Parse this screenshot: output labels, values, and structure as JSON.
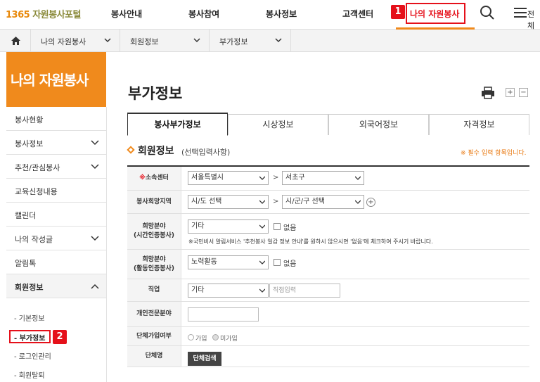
{
  "header": {
    "logo_num": "1365",
    "logo_text": "자원봉사포털",
    "nav": [
      "봉사안내",
      "봉사참여",
      "봉사정보",
      "고객센터",
      "나의 자원봉사"
    ],
    "menu_label": "전체",
    "badge1": "1",
    "icons": [
      "search-icon",
      "menu-icon"
    ]
  },
  "breadcrumb": [
    "나의 자원봉사",
    "회원정보",
    "부가정보"
  ],
  "sidebar": {
    "title": "나의 자원봉사",
    "items": [
      "봉사현황",
      "봉사정보",
      "추천/관심봉사",
      "교육신청내용",
      "캘린더",
      "나의 작성글",
      "알림톡",
      "회원정보"
    ],
    "sub_items": [
      "- 기본정보",
      "- 부가정보",
      "- 로그인관리",
      "- 회원탈퇴"
    ],
    "badge2": "2"
  },
  "main": {
    "title": "부가정보",
    "tabs": [
      "봉사부가정보",
      "시상정보",
      "외국어정보",
      "자격정보"
    ],
    "section_title": "회원정보",
    "section_sub": "(선택입력사항)",
    "required_note": "※ 필수 입력 항목입니다.",
    "zoom_plus": "+",
    "zoom_minus": "−"
  },
  "form": {
    "center_req": "※",
    "center_label": "소속센터",
    "center_sido": "서울특별시",
    "center_gu": "서초구",
    "region_label": "봉사희망지역",
    "region_sido": "시/도 선택",
    "region_gu": "시/군/구 선택",
    "gt": ">",
    "plus": "+",
    "field1_label1": "희망분야",
    "field1_label2": "(시간인증봉사)",
    "field1_value": "기타",
    "none_label": "없음",
    "field1_note": "※국민비서 알림서비스 '추천봉사 일감 정보 안내'를 원하시 않으시면 '없음'에 체크하여 주시기 바랍니다.",
    "field2_label1": "희망분야",
    "field2_label2": "(활동인증봉사)",
    "field2_value": "노력활동",
    "job_label": "직업",
    "job_value": "기타",
    "job_placeholder": "직접입력",
    "expert_label": "개인전문분야",
    "group_join_label": "단체가입여부",
    "radio_join": "가입",
    "radio_notjoin": "미가입",
    "group_name_label": "단체명",
    "group_search_btn": "단체검색"
  }
}
